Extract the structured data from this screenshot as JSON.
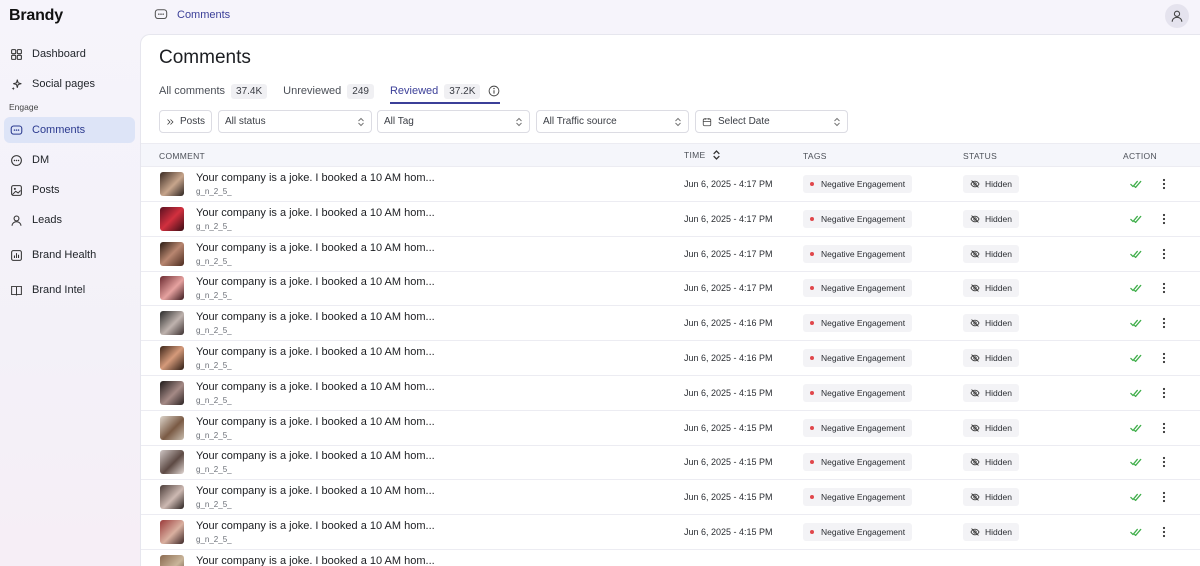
{
  "app": {
    "logo": "Brandy"
  },
  "breadcrumb": {
    "icon": "chat-bubble-icon",
    "label": "Comments"
  },
  "sidebar": {
    "items_top": [
      {
        "label": "Dashboard",
        "icon": "grid-icon"
      },
      {
        "label": "Social pages",
        "icon": "sparkle-icon"
      }
    ],
    "section": "Engage",
    "items_engage": [
      {
        "label": "Comments",
        "icon": "comment-icon",
        "active": true
      },
      {
        "label": "DM",
        "icon": "dm-icon"
      },
      {
        "label": "Posts",
        "icon": "image-icon"
      },
      {
        "label": "Leads",
        "icon": "user-icon"
      }
    ],
    "items_bottom": [
      {
        "label": "Brand Health",
        "icon": "chart-icon"
      },
      {
        "label": "Brand Intel",
        "icon": "book-icon"
      }
    ]
  },
  "page": {
    "title": "Comments"
  },
  "tabs": [
    {
      "label": "All comments",
      "count": "37.4K"
    },
    {
      "label": "Unreviewed",
      "count": "249"
    },
    {
      "label": "Reviewed",
      "count": "37.2K",
      "active": true
    }
  ],
  "filters": {
    "posts": "Posts",
    "status": "All status",
    "tag": "All Tag",
    "traffic": "All Traffic source",
    "date": "Select Date"
  },
  "table": {
    "headers": {
      "comment": "COMMENT",
      "time": "TIME",
      "tags": "TAGS",
      "status": "STATUS",
      "action": "ACTION"
    },
    "rows": [
      {
        "comment": "Your company is a joke. I booked a 10 AM hom...",
        "user": "g_n_2_5_",
        "time": "Jun 6, 2025 - 4:17 PM",
        "tag": "Negative Engagement",
        "status": "Hidden"
      },
      {
        "comment": "Your company is a joke. I booked a 10 AM hom...",
        "user": "g_n_2_5_",
        "time": "Jun 6, 2025 - 4:17 PM",
        "tag": "Negative Engagement",
        "status": "Hidden"
      },
      {
        "comment": "Your company is a joke. I booked a 10 AM hom...",
        "user": "g_n_2_5_",
        "time": "Jun 6, 2025 - 4:17 PM",
        "tag": "Negative Engagement",
        "status": "Hidden"
      },
      {
        "comment": "Your company is a joke. I booked a 10 AM hom...",
        "user": "g_n_2_5_",
        "time": "Jun 6, 2025 - 4:17 PM",
        "tag": "Negative Engagement",
        "status": "Hidden"
      },
      {
        "comment": "Your company is a joke. I booked a 10 AM hom...",
        "user": "g_n_2_5_",
        "time": "Jun 6, 2025 - 4:16 PM",
        "tag": "Negative Engagement",
        "status": "Hidden"
      },
      {
        "comment": "Your company is a joke. I booked a 10 AM hom...",
        "user": "g_n_2_5_",
        "time": "Jun 6, 2025 - 4:16 PM",
        "tag": "Negative Engagement",
        "status": "Hidden"
      },
      {
        "comment": "Your company is a joke. I booked a 10 AM hom...",
        "user": "g_n_2_5_",
        "time": "Jun 6, 2025 - 4:15 PM",
        "tag": "Negative Engagement",
        "status": "Hidden"
      },
      {
        "comment": "Your company is a joke. I booked a 10 AM hom...",
        "user": "g_n_2_5_",
        "time": "Jun 6, 2025 - 4:15 PM",
        "tag": "Negative Engagement",
        "status": "Hidden"
      },
      {
        "comment": "Your company is a joke. I booked a 10 AM hom...",
        "user": "g_n_2_5_",
        "time": "Jun 6, 2025 - 4:15 PM",
        "tag": "Negative Engagement",
        "status": "Hidden"
      },
      {
        "comment": "Your company is a joke. I booked a 10 AM hom...",
        "user": "g_n_2_5_",
        "time": "Jun 6, 2025 - 4:15 PM",
        "tag": "Negative Engagement",
        "status": "Hidden"
      },
      {
        "comment": "Your company is a joke. I booked a 10 AM hom...",
        "user": "g_n_2_5_",
        "time": "Jun 6, 2025 - 4:15 PM",
        "tag": "Negative Engagement",
        "status": "Hidden"
      },
      {
        "comment": "Your company is a joke. I booked a 10 AM hom...",
        "user": "",
        "time": "",
        "tag": "",
        "status": ""
      }
    ]
  },
  "colors": {
    "accent": "#3b3f98",
    "active_nav_bg": "#dde4f7",
    "tag_dot": "#e0474b",
    "check": "#3fae4a"
  }
}
